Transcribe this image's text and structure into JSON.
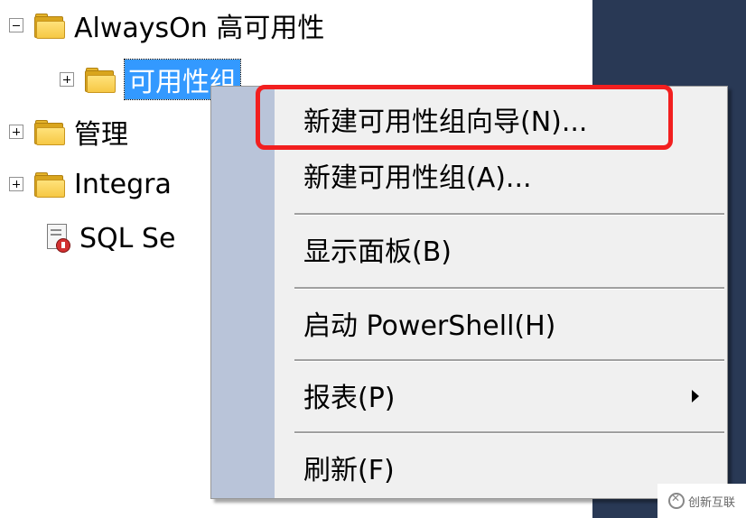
{
  "tree": {
    "items": [
      {
        "label": "AlwaysOn 高可用性",
        "expander": "minus",
        "icon": "folder-icon"
      },
      {
        "label": "可用性组",
        "expander": "plus",
        "icon": "folder-icon",
        "selected": true
      },
      {
        "label": "管理",
        "expander": "plus",
        "icon": "folder-icon"
      },
      {
        "label": "Integra",
        "expander": "plus",
        "icon": "folder-icon"
      },
      {
        "label": "SQL Se",
        "icon": "sql-server-log-icon"
      }
    ]
  },
  "context_menu": {
    "items": [
      {
        "label": "新建可用性组向导(N)..."
      },
      {
        "label": "新建可用性组(A)..."
      },
      {
        "label": "显示面板(B)"
      },
      {
        "label": "启动 PowerShell(H)"
      },
      {
        "label": "报表(P)",
        "has_submenu": true
      },
      {
        "label": "刷新(F)"
      }
    ],
    "highlighted_index": 0
  },
  "colors": {
    "selection": "#3399ff",
    "menu_gutter": "#b9c4d9",
    "highlight_box": "#f21f1f",
    "right_panel": "#293955"
  },
  "watermark": {
    "text": "创新互联"
  }
}
